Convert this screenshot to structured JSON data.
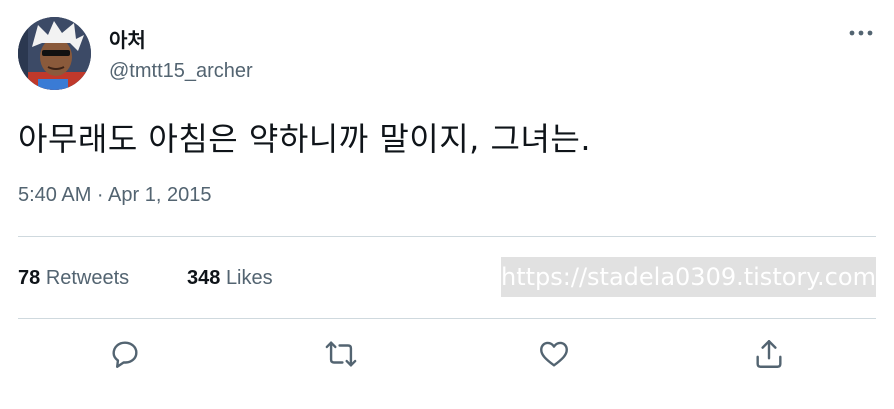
{
  "author": {
    "display_name": "아처",
    "handle": "@tmtt15_archer",
    "avatar_icon": "anime-character-avatar"
  },
  "tweet": {
    "text": "아무래도 아침은 약하니까 말이지, 그녀는.",
    "timestamp": "5:40 AM · Apr 1, 2015"
  },
  "stats": {
    "retweets_count": "78",
    "retweets_label": "Retweets",
    "likes_count": "348",
    "likes_label": "Likes"
  },
  "watermark": "https://stadela0309.tistory.com",
  "actions": [
    {
      "icon": "reply-icon"
    },
    {
      "icon": "retweet-icon"
    },
    {
      "icon": "like-icon"
    },
    {
      "icon": "share-icon"
    }
  ],
  "colors": {
    "text_primary": "#0f1419",
    "text_secondary": "#536471",
    "divider": "#cfd9de"
  }
}
